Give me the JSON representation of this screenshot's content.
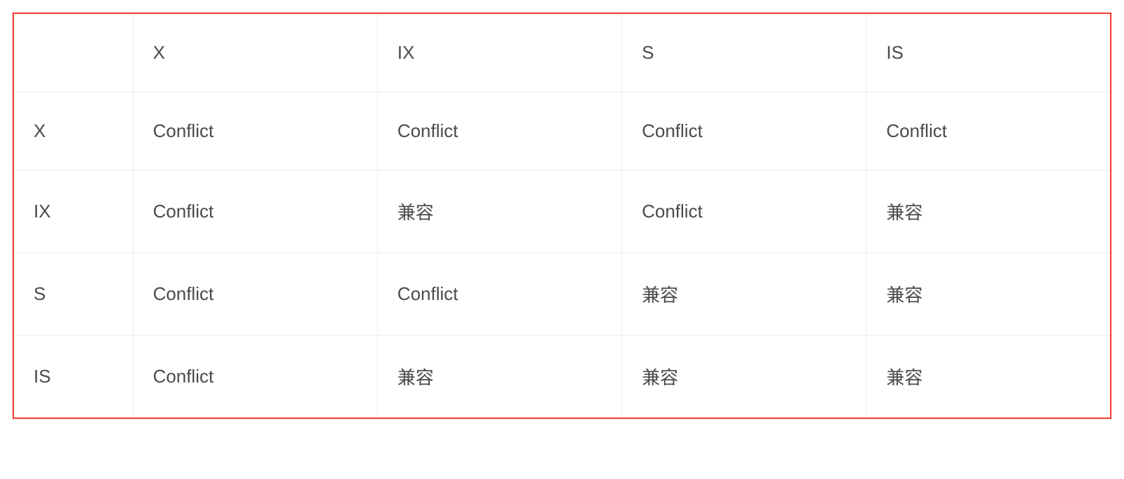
{
  "table": {
    "corner": "",
    "colHeaders": [
      "X",
      "IX",
      "S",
      "IS"
    ],
    "rows": [
      {
        "header": "X",
        "cells": [
          "Conflict",
          "Conflict",
          "Conflict",
          "Conflict"
        ]
      },
      {
        "header": "IX",
        "cells": [
          "Conflict",
          "兼容",
          "Conflict",
          "兼容"
        ]
      },
      {
        "header": "S",
        "cells": [
          "Conflict",
          "Conflict",
          "兼容",
          "兼容"
        ]
      },
      {
        "header": "IS",
        "cells": [
          "Conflict",
          "兼容",
          "兼容",
          "兼容"
        ]
      }
    ]
  },
  "chart_data": {
    "type": "table",
    "title": "",
    "columns": [
      "",
      "X",
      "IX",
      "S",
      "IS"
    ],
    "rows": [
      [
        "X",
        "Conflict",
        "Conflict",
        "Conflict",
        "Conflict"
      ],
      [
        "IX",
        "Conflict",
        "兼容",
        "Conflict",
        "兼容"
      ],
      [
        "S",
        "Conflict",
        "Conflict",
        "兼容",
        "兼容"
      ],
      [
        "IS",
        "Conflict",
        "兼容",
        "兼容",
        "兼容"
      ]
    ]
  }
}
